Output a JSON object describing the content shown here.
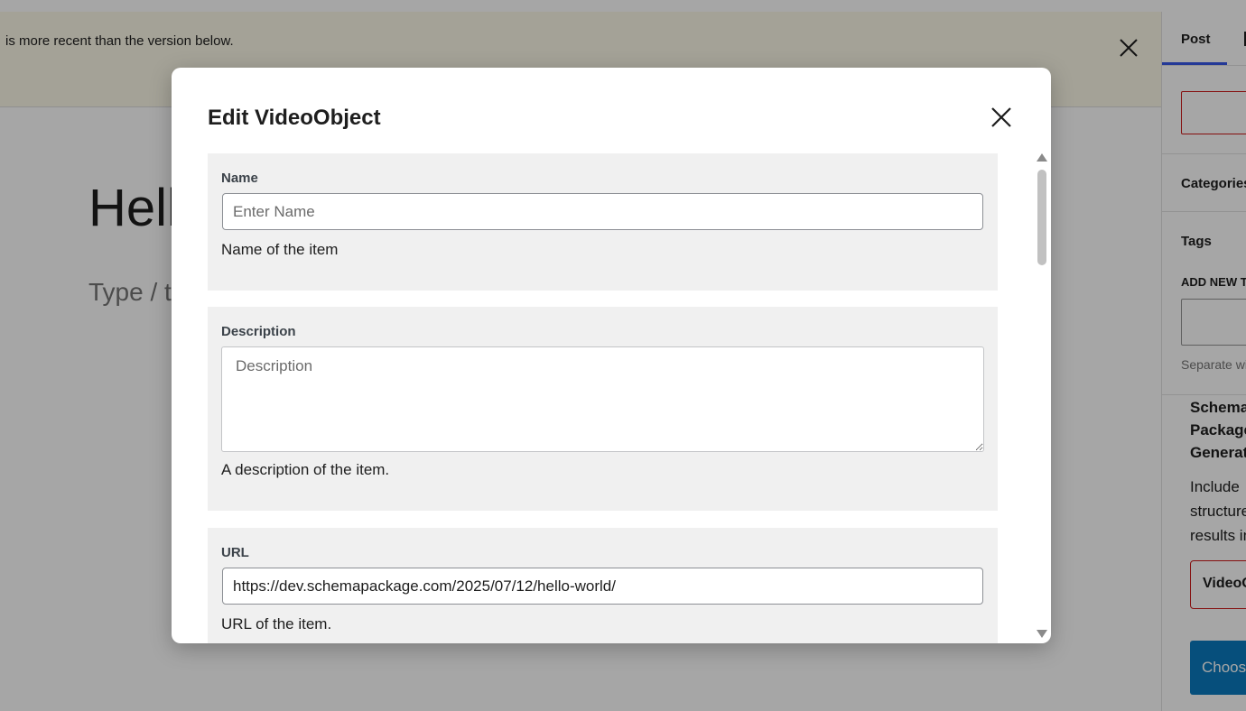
{
  "notice": {
    "text": "is more recent than the version below."
  },
  "editor": {
    "title": "Hello world!",
    "placeholder": "Type / to choose a block"
  },
  "sidebar": {
    "tab_post": "Post",
    "categories_heading": "Categories",
    "tags_heading": "Tags",
    "add_new_tag_label": "ADD NEW TAG",
    "separate_help": "Separate with commas",
    "schema_heading": "Schema Package Generator",
    "include_text": "Include structured results in",
    "video_button": "VideoObject",
    "choose_button": "Choose"
  },
  "modal": {
    "title": "Edit VideoObject",
    "fields": {
      "name": {
        "label": "Name",
        "placeholder": "Enter Name",
        "value": "",
        "description": "Name of the item"
      },
      "description": {
        "label": "Description",
        "placeholder": "Description",
        "value": "",
        "description": "A description of the item."
      },
      "url": {
        "label": "URL",
        "placeholder": "",
        "value": "https://dev.schemapackage.com/2025/07/12/hello-world/",
        "description": "URL of the item."
      }
    }
  },
  "colors": {
    "accent": "#3858e9",
    "error_border": "#cc1818",
    "primary_button": "#0a7abf",
    "field_background": "#f0f0f0",
    "notice_background": "#fcf9e8"
  },
  "icons": {
    "notice_close": "close-icon",
    "modal_close": "close-icon",
    "scroll_up": "triangle-up-icon",
    "scroll_down": "triangle-down-icon"
  }
}
